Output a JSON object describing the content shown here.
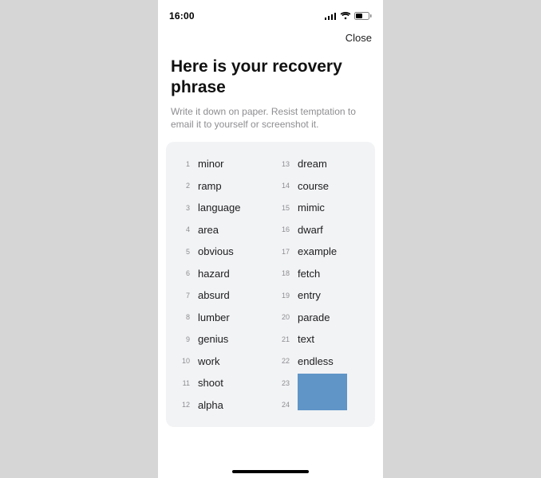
{
  "status_bar": {
    "time": "16:00"
  },
  "top_bar": {
    "close_label": "Close"
  },
  "header": {
    "title": "Here is your recovery phrase",
    "subtitle": "Write it down on paper. Resist temptation to email it to yourself or screenshot it."
  },
  "phrase": {
    "col1": [
      {
        "n": "1",
        "w": "minor"
      },
      {
        "n": "2",
        "w": "ramp"
      },
      {
        "n": "3",
        "w": "language"
      },
      {
        "n": "4",
        "w": "area"
      },
      {
        "n": "5",
        "w": "obvious"
      },
      {
        "n": "6",
        "w": "hazard"
      },
      {
        "n": "7",
        "w": "absurd"
      },
      {
        "n": "8",
        "w": "lumber"
      },
      {
        "n": "9",
        "w": "genius"
      },
      {
        "n": "10",
        "w": "work"
      },
      {
        "n": "11",
        "w": "shoot"
      },
      {
        "n": "12",
        "w": "alpha"
      }
    ],
    "col2": [
      {
        "n": "13",
        "w": "dream"
      },
      {
        "n": "14",
        "w": "course"
      },
      {
        "n": "15",
        "w": "mimic"
      },
      {
        "n": "16",
        "w": "dwarf"
      },
      {
        "n": "17",
        "w": "example"
      },
      {
        "n": "18",
        "w": "fetch"
      },
      {
        "n": "19",
        "w": "entry"
      },
      {
        "n": "20",
        "w": "parade"
      },
      {
        "n": "21",
        "w": "text"
      },
      {
        "n": "22",
        "w": "endless"
      }
    ],
    "col2_redacted": [
      {
        "n": "23"
      },
      {
        "n": "24"
      }
    ]
  }
}
